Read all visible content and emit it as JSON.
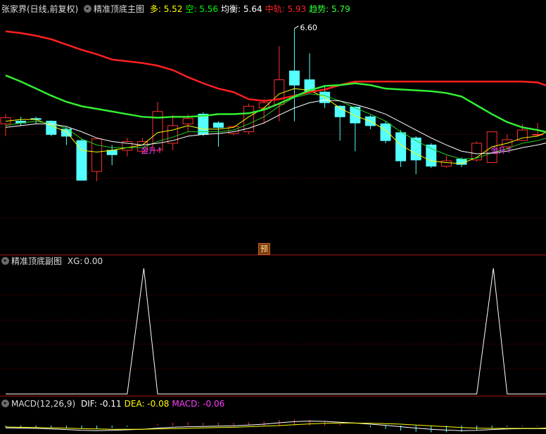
{
  "main_header": {
    "symbol": "张家界(日线,前复权)",
    "indicator": "精准顶底主图",
    "items": [
      {
        "label": "多:",
        "value": "5.52",
        "color": "#ffff00"
      },
      {
        "label": "空:",
        "value": "5.56",
        "color": "#00ff00"
      },
      {
        "label": "均衡:",
        "value": "5.64",
        "color": "#ffffff"
      },
      {
        "label": "中轨:",
        "value": "5.93",
        "color": "#ff2020"
      },
      {
        "label": "趋势:",
        "value": "5.79",
        "color": "#33ff33"
      }
    ]
  },
  "sub_header": {
    "indicator": "精准顶底副图",
    "label": "XG:",
    "value": "0.00"
  },
  "macd_header": {
    "name": "MACD(12,26,9)",
    "items": [
      {
        "label": "DIF:",
        "value": "-0.11",
        "color": "#ffffff"
      },
      {
        "label": "DEA:",
        "value": "-0.08",
        "color": "#ffff00"
      },
      {
        "label": "MACD:",
        "value": "-0.06",
        "color": "#ff40ff"
      }
    ]
  },
  "high_marker": "6.60",
  "yu_marker": "预",
  "buy_signals": [
    "金升↑",
    "金升↑"
  ],
  "colors": {
    "up": "#ff3030",
    "down": "#54ffff",
    "grid": "#8b0000",
    "ma_white": "#ffffff",
    "ma_yellow": "#ffff00",
    "ma_green": "#22cc22",
    "zhonggui": "#ff2020",
    "qushi": "#33ee33"
  },
  "chart_data": [
    {
      "type": "candlestick",
      "title": "精准顶底主图",
      "ylim": [
        4.2,
        6.75
      ],
      "x": [
        1,
        2,
        3,
        4,
        5,
        6,
        7,
        8,
        9,
        10,
        11,
        12,
        13,
        14,
        15,
        16,
        17,
        18,
        19,
        20,
        21,
        22,
        23,
        24,
        25,
        26,
        27,
        28,
        29,
        30,
        31,
        32,
        33,
        34,
        35,
        36,
        37
      ],
      "open": [
        5.52,
        5.55,
        5.58,
        5.55,
        5.46,
        5.33,
        4.98,
        5.22,
        5.22,
        5.21,
        5.22,
        5.3,
        5.52,
        5.63,
        5.53,
        5.41,
        5.43,
        5.7,
        5.74,
        6.12,
        6.02,
        5.88,
        5.72,
        5.71,
        5.6,
        5.52,
        5.42,
        5.36,
        5.28,
        5.04,
        5.12,
        5.11,
        5.08,
        5.26,
        5.33,
        5.4,
        5.4
      ],
      "close": [
        5.59,
        5.53,
        5.57,
        5.4,
        5.38,
        4.88,
        5.35,
        5.17,
        5.32,
        5.32,
        5.66,
        5.5,
        5.58,
        5.4,
        5.48,
        5.49,
        5.72,
        5.76,
        6.02,
        5.96,
        5.88,
        5.76,
        5.6,
        5.53,
        5.5,
        5.33,
        5.1,
        5.11,
        5.04,
        5.1,
        5.06,
        5.3,
        5.43,
        5.34,
        5.45,
        5.4,
        5.55
      ],
      "high": [
        5.63,
        5.6,
        5.6,
        5.56,
        5.48,
        5.35,
        5.35,
        5.28,
        5.36,
        5.36,
        5.77,
        5.62,
        5.63,
        5.65,
        5.55,
        5.5,
        5.75,
        5.8,
        6.4,
        6.6,
        6.32,
        5.95,
        5.73,
        5.72,
        5.62,
        5.55,
        5.45,
        5.38,
        5.3,
        5.16,
        5.14,
        5.32,
        5.43,
        5.4,
        5.52,
        5.53,
        5.57
      ],
      "low": [
        5.38,
        5.5,
        5.52,
        5.38,
        5.28,
        4.88,
        4.87,
        5.05,
        5.15,
        5.18,
        5.2,
        5.22,
        5.43,
        5.38,
        5.26,
        5.39,
        5.4,
        5.52,
        5.55,
        5.55,
        5.88,
        5.7,
        5.33,
        5.21,
        5.46,
        5.3,
        5.03,
        4.95,
        5.02,
        5.02,
        5.03,
        5.09,
        5.29,
        5.22,
        5.34,
        5.38,
        5.38
      ],
      "series": [
        {
          "name": "多",
          "values": [
            5.55,
            5.57,
            5.57,
            5.5,
            5.43,
            5.22,
            5.2,
            5.22,
            5.25,
            5.28,
            5.42,
            5.45,
            5.5,
            5.46,
            5.46,
            5.48,
            5.6,
            5.7,
            5.86,
            5.92,
            5.9,
            5.82,
            5.7,
            5.61,
            5.55,
            5.45,
            5.28,
            5.18,
            5.1,
            5.08,
            5.07,
            5.14,
            5.26,
            5.3,
            5.36,
            5.38,
            5.46
          ]
        },
        {
          "name": "空",
          "values": [
            5.5,
            5.53,
            5.55,
            5.52,
            5.47,
            5.35,
            5.28,
            5.25,
            5.25,
            5.25,
            5.32,
            5.37,
            5.43,
            5.43,
            5.43,
            5.45,
            5.52,
            5.6,
            5.72,
            5.82,
            5.86,
            5.84,
            5.78,
            5.7,
            5.63,
            5.55,
            5.43,
            5.33,
            5.24,
            5.17,
            5.12,
            5.13,
            5.19,
            5.24,
            5.3,
            5.33,
            5.38
          ]
        },
        {
          "name": "均衡",
          "values": [
            5.48,
            5.5,
            5.52,
            5.52,
            5.49,
            5.43,
            5.36,
            5.32,
            5.3,
            5.28,
            5.3,
            5.33,
            5.38,
            5.4,
            5.41,
            5.43,
            5.47,
            5.53,
            5.62,
            5.7,
            5.76,
            5.79,
            5.78,
            5.74,
            5.69,
            5.63,
            5.54,
            5.45,
            5.36,
            5.28,
            5.21,
            5.18,
            5.19,
            5.21,
            5.25,
            5.28,
            5.32
          ]
        },
        {
          "name": "中轨",
          "values": [
            6.57,
            6.55,
            6.52,
            6.48,
            6.42,
            6.36,
            6.31,
            6.25,
            6.23,
            6.21,
            6.18,
            6.13,
            6.05,
            5.98,
            5.92,
            5.88,
            5.8,
            5.78,
            5.8,
            5.84,
            5.88,
            5.91,
            5.96,
            6.0,
            6.0,
            6.0,
            6.0,
            6.0,
            6.0,
            6.0,
            6.0,
            6.0,
            6.0,
            6.0,
            6.0,
            5.99,
            5.93
          ]
        },
        {
          "name": "趋势",
          "values": [
            6.07,
            6.0,
            5.92,
            5.84,
            5.77,
            5.72,
            5.69,
            5.66,
            5.63,
            5.6,
            5.59,
            5.6,
            5.6,
            5.61,
            5.63,
            5.63,
            5.64,
            5.68,
            5.75,
            5.83,
            5.9,
            5.95,
            5.96,
            5.98,
            5.96,
            5.92,
            5.91,
            5.9,
            5.89,
            5.87,
            5.83,
            5.73,
            5.63,
            5.54,
            5.48,
            5.45,
            5.41
          ]
        }
      ],
      "signals": [
        {
          "text": "金升↑",
          "x": 10
        },
        {
          "text": "金升↑",
          "x": 33
        }
      ],
      "annotations": [
        {
          "text": "6.60",
          "x": 20
        },
        {
          "text": "预",
          "x": 19
        }
      ]
    },
    {
      "type": "line",
      "title": "精准顶底副图",
      "series": [
        {
          "name": "XG",
          "values": [
            0,
            0,
            0,
            0,
            0,
            0,
            0,
            0,
            0,
            1,
            0,
            0,
            0,
            0,
            0,
            0,
            0,
            0,
            0,
            0,
            0,
            0,
            0,
            0,
            0,
            0,
            0,
            0,
            0,
            0,
            0,
            0,
            1,
            0,
            0,
            0,
            0
          ]
        }
      ],
      "ylim": [
        0,
        1
      ]
    },
    {
      "type": "line",
      "title": "MACD(12,26,9)",
      "series": [
        {
          "name": "DIF",
          "values": [
            -0.08,
            -0.09,
            -0.1,
            -0.12,
            -0.14,
            -0.17,
            -0.18,
            -0.17,
            -0.15,
            -0.13,
            -0.09,
            -0.06,
            -0.04,
            -0.03,
            -0.02,
            -0.01,
            0.02,
            0.05,
            0.1,
            0.14,
            0.16,
            0.15,
            0.12,
            0.09,
            0.05,
            0.01,
            -0.04,
            -0.09,
            -0.13,
            -0.16,
            -0.18,
            -0.17,
            -0.14,
            -0.12,
            -0.11,
            -0.11,
            -0.11
          ]
        },
        {
          "name": "DEA",
          "values": [
            -0.05,
            -0.06,
            -0.07,
            -0.08,
            -0.09,
            -0.11,
            -0.12,
            -0.13,
            -0.13,
            -0.13,
            -0.12,
            -0.11,
            -0.1,
            -0.08,
            -0.07,
            -0.06,
            -0.04,
            -0.02,
            0.0,
            0.03,
            0.06,
            0.08,
            0.09,
            0.09,
            0.08,
            0.07,
            0.05,
            0.02,
            -0.01,
            -0.04,
            -0.07,
            -0.09,
            -0.1,
            -0.1,
            -0.1,
            -0.1,
            -0.08
          ]
        },
        {
          "name": "MACD",
          "values": [
            -0.06,
            -0.06,
            -0.06,
            -0.08,
            -0.1,
            -0.12,
            -0.12,
            -0.08,
            -0.04,
            0.0,
            0.06,
            0.1,
            0.12,
            0.1,
            0.1,
            0.1,
            0.12,
            0.14,
            0.2,
            0.22,
            0.2,
            0.14,
            0.06,
            0.0,
            -0.06,
            -0.12,
            -0.18,
            -0.22,
            -0.24,
            -0.24,
            -0.22,
            -0.16,
            -0.08,
            -0.04,
            -0.02,
            -0.02,
            -0.06
          ]
        }
      ]
    }
  ]
}
